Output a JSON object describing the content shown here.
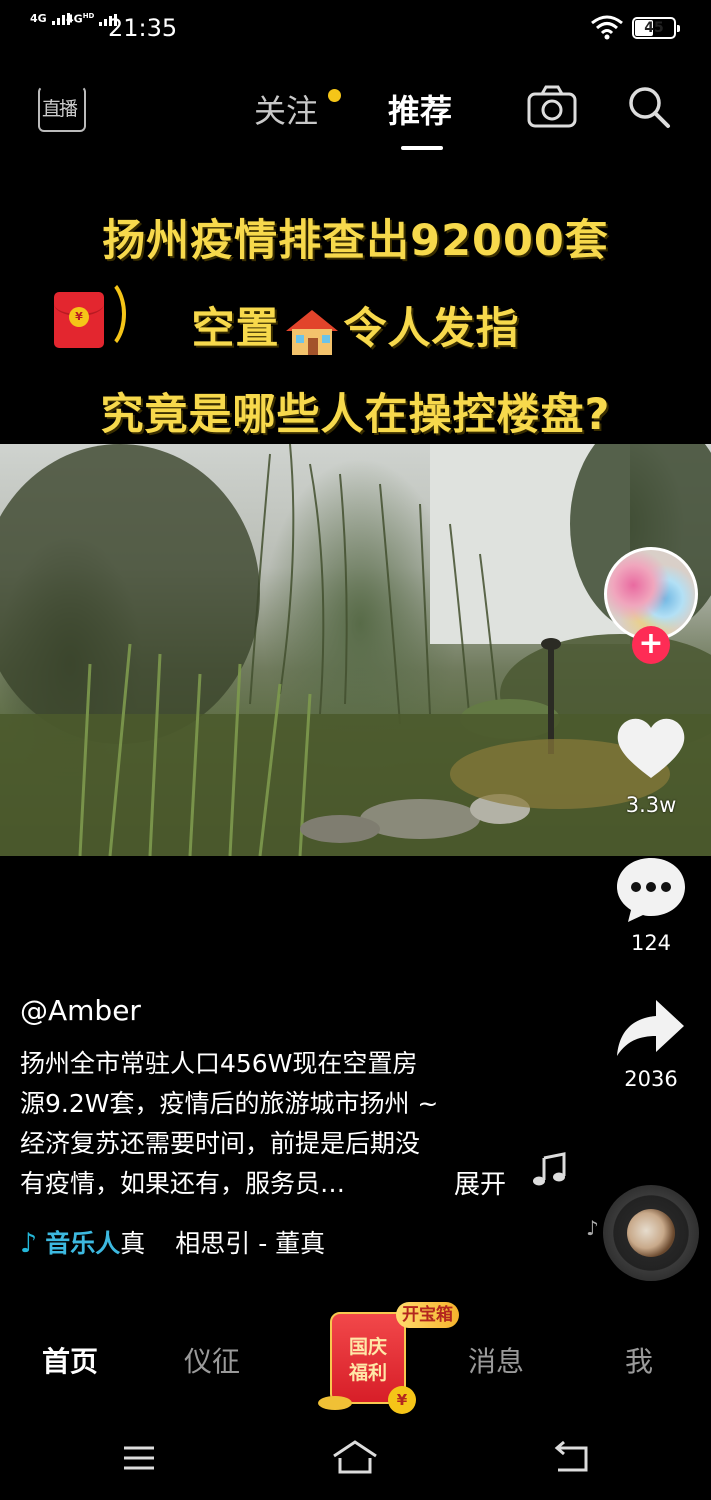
{
  "status_bar": {
    "signal_1": "4G",
    "signal_2": "4G",
    "signal_2_sup": "HD",
    "time": "21:35",
    "battery_level": "45"
  },
  "top_nav": {
    "live_label": "直播",
    "follow_tab": "关注",
    "recommend_tab": "推荐",
    "active_tab": "推荐",
    "follow_has_update": true,
    "icons": [
      "live-icon",
      "camera-icon",
      "search-icon"
    ]
  },
  "video_overlay": {
    "headline_line1": "扬州疫情排查出92000套",
    "headline_line2_before": "空置",
    "headline_line2_after": "令人发指",
    "headline_line3": "究竟是哪些人在操控楼盘?",
    "emoji_icon": "house-icon",
    "redpacket_icon": "red-packet-icon",
    "accent_color": "#f7d94c"
  },
  "right_rail": {
    "likes": "3.3w",
    "comments": "124",
    "shares": "2036",
    "follow_button": "+",
    "accent_color": "#fe2c55"
  },
  "post": {
    "author": "@Amber",
    "caption_lines": [
      "扬州全市常驻人口456W现在空置房",
      "源9.2W套，疫情后的旅游城市扬州 ~",
      "经济复苏还需要时间，前提是后期没",
      "有疫情，如果还有，服务员…"
    ],
    "expand_label": "展开",
    "music_tag": "音乐人",
    "music_tag_suffix": "真",
    "music_title": "相思引 - 董真"
  },
  "bottom_tabs": {
    "home": "首页",
    "city": "仪征",
    "messages": "消息",
    "me": "我",
    "active": "首页",
    "promo_badge": "开宝箱",
    "promo_line1": "国庆",
    "promo_line2": "福利",
    "promo_coin": "¥"
  },
  "system_nav": [
    "menu-icon",
    "home-icon",
    "back-icon"
  ]
}
